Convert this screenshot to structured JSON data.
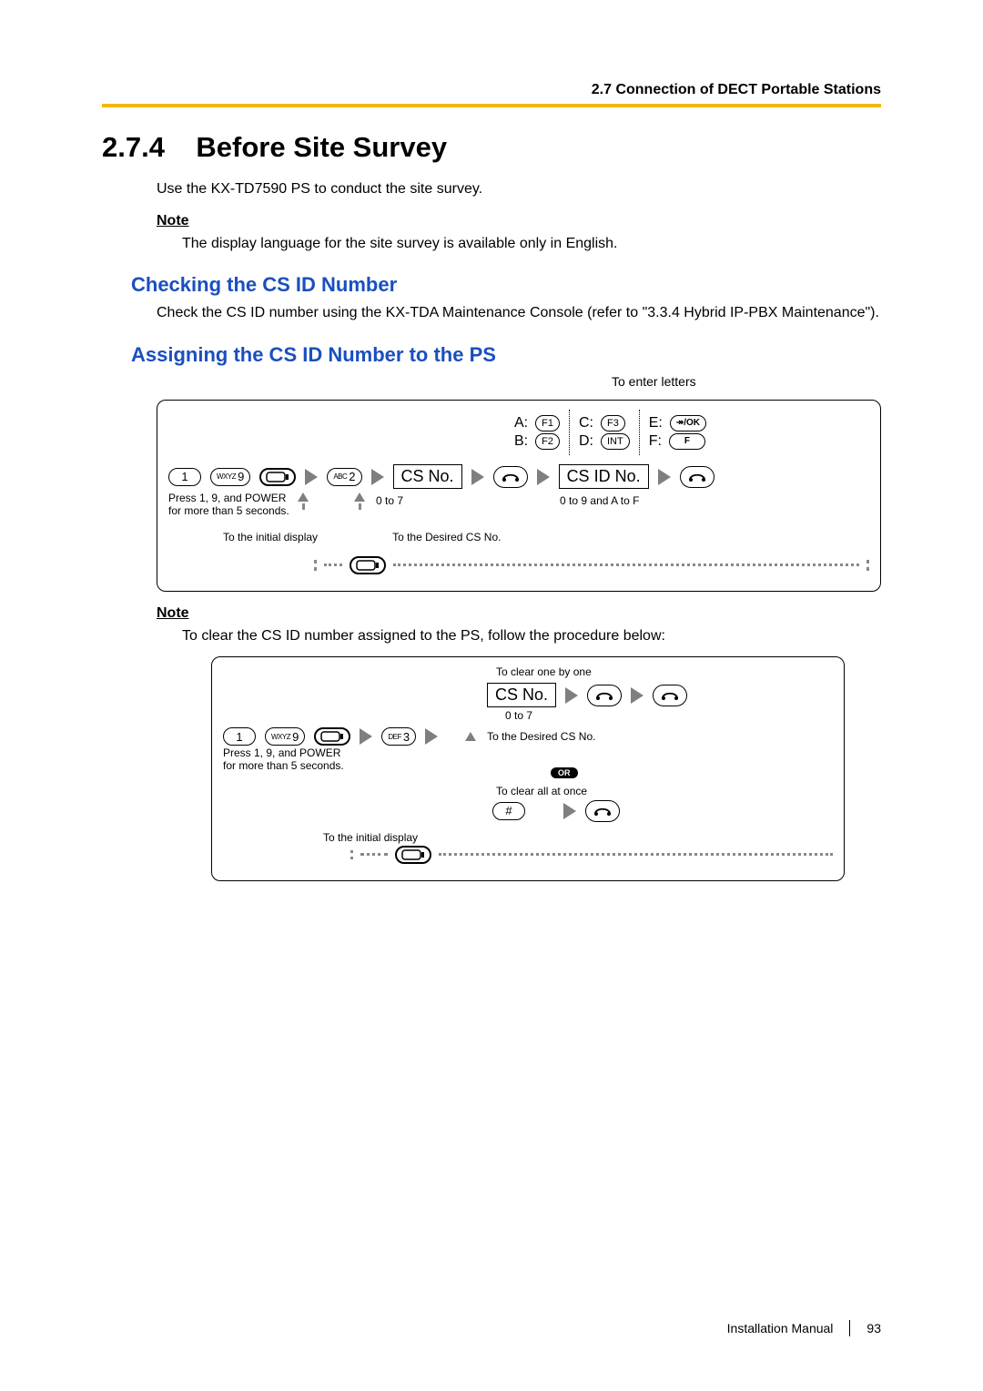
{
  "header": {
    "breadcrumb": "2.7 Connection of DECT Portable Stations"
  },
  "section": {
    "number": "2.7.4",
    "title": "Before Site Survey",
    "intro": "Use the KX-TD7590 PS to conduct the site survey.",
    "note_label": "Note",
    "note1": "The display language for the site survey is available only in English."
  },
  "sub1": {
    "title": "Checking the CS ID Number",
    "body": "Check the CS ID number using the KX-TDA Maintenance Console (refer to \"3.3.4 Hybrid IP-PBX Maintenance\")."
  },
  "sub2": {
    "title": "Assigning the CS ID Number to the PS",
    "letters_hdr": "To enter letters",
    "map": {
      "A": "A:",
      "A_key": "F1",
      "B": "B:",
      "B_key": "F2",
      "C": "C:",
      "C_key": "F3",
      "D": "D:",
      "D_key": "INT",
      "E": "E:",
      "E_key": "↠/OK",
      "F": "F:",
      "F_key": "F"
    },
    "flow": {
      "k1": "1",
      "k9_sup": "WXYZ",
      "k9": "9",
      "press_hint": "Press 1, 9, and POWER\nfor more than 5 seconds.",
      "k2_sup": "ABC",
      "k2": "2",
      "csno": "CS No.",
      "range1": "0 to 7",
      "csid": "CS ID No.",
      "range2": "0 to 9 and A to F",
      "to_initial": "To the initial display",
      "to_desired": "To the Desired  CS No."
    },
    "note2_label": "Note",
    "note2": "To clear the CS ID number assigned to the PS, follow the procedure below:"
  },
  "clear": {
    "k1": "1",
    "k9_sup": "WXYZ",
    "k9": "9",
    "press_hint": "Press 1, 9, and POWER\nfor more than 5 seconds.",
    "k3_sup": "DEF",
    "k3": "3",
    "hdr_one": "To clear one by one",
    "csno": "CS No.",
    "range": "0 to 7",
    "to_desired": "To the Desired  CS No.",
    "or": "OR",
    "hdr_all": "To clear all at once",
    "hash": "#",
    "to_initial": "To the initial display"
  },
  "footer": {
    "manual": "Installation Manual",
    "page": "93"
  }
}
